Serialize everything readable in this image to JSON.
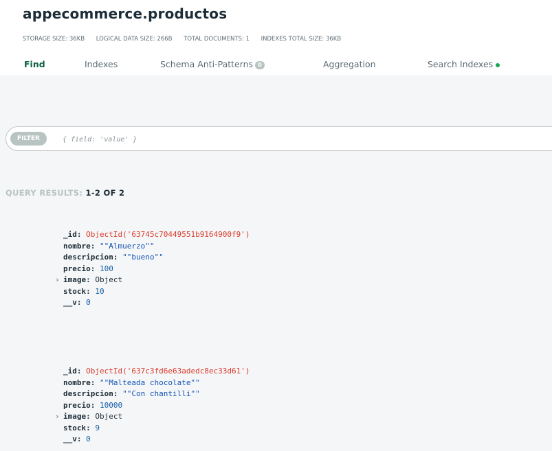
{
  "collection": {
    "title": "appecommerce.productos",
    "stats": [
      "STORAGE SIZE: 36KB",
      "LOGICAL DATA SIZE: 266B",
      "TOTAL DOCUMENTS: 1",
      "INDEXES TOTAL SIZE: 36KB"
    ]
  },
  "tabs": [
    {
      "label": "Find",
      "active": true
    },
    {
      "label": "Indexes"
    },
    {
      "label": "Schema Anti-Patterns",
      "badge": "0"
    },
    {
      "label": "Aggregation"
    },
    {
      "label": "Search Indexes",
      "status_dot_color": "#13aa52"
    }
  ],
  "filter": {
    "pill_label": "FILTER",
    "placeholder": "{ field: 'value' }"
  },
  "results": {
    "label": "QUERY RESULTS:",
    "count": "1-2 OF 2"
  },
  "documents": [
    {
      "id_key": "_id:",
      "id_value": "ObjectId('63745c70449551b9164900f9')",
      "nombre_key": "nombre:",
      "nombre_value": "\"\"Almuerzo\"\"",
      "descripcion_key": "descripcion:",
      "descripcion_value": "\"\"bueno\"\"",
      "precio_key": "precio:",
      "precio_value": "100",
      "image_key": "image:",
      "image_value": "Object",
      "stock_key": "stock:",
      "stock_value": "10",
      "v_key": "__v:",
      "v_value": "0"
    },
    {
      "id_key": "_id:",
      "id_value": "ObjectId('637c3fd6e63adedc8ec33d61')",
      "nombre_key": "nombre:",
      "nombre_value": "\"\"Malteada chocolate\"\"",
      "descripcion_key": "descripcion:",
      "descripcion_value": "\"\"Con chantilli\"\"",
      "precio_key": "precio:",
      "precio_value": "10000",
      "image_key": "image:",
      "image_value": "Object",
      "stock_key": "stock:",
      "stock_value": "9",
      "v_key": "__v:",
      "v_value": "0"
    }
  ],
  "colors": {
    "active_tab": "#116149",
    "object_id": "#db3b2c",
    "string_value": "#1254b7",
    "background_band": "#f5f6f7"
  }
}
